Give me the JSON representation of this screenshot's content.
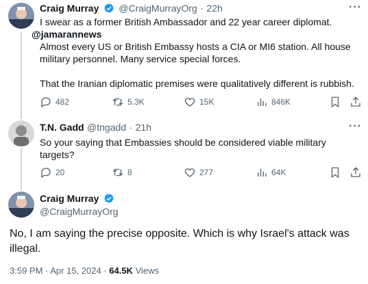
{
  "watermark": "@jamarannews",
  "tweet1": {
    "name": "Craig Murray",
    "handle": "@CraigMurrayOrg",
    "time": "22h",
    "line1": "I swear as a former British Ambassador and 22 year career diplomat.",
    "line2": "Almost every US or British Embassy hosts a CIA or MI6 station. All house",
    "line3": "military personnel.  Many service special forces.",
    "line4": "That the Iranian diplomatic premises were qualitatively different is rubbish.",
    "replies": "482",
    "retweets": "5.3K",
    "likes": "15K",
    "views": "846K"
  },
  "tweet2": {
    "name": "T.N. Gadd",
    "handle": "@tngadd",
    "time": "21h",
    "line1": "So your saying that Embassies should be considered viable military",
    "line2": "targets?",
    "replies": "20",
    "retweets": "8",
    "likes": "277",
    "views": "64K"
  },
  "tweet3": {
    "name": "Craig Murray",
    "handle": "@CraigMurrayOrg",
    "line1": "No, I am saying the precise opposite. Which is why Israel's attack was",
    "line2": "illegal.",
    "timestamp": "3:59 PM · Apr 15, 2024 · ",
    "views_count": "64.5K",
    "views_label": " Views"
  },
  "sep": "·",
  "more_glyph": "···",
  "colors": {
    "verified": "#1d9bf0",
    "muted": "#536471",
    "text": "#0f1419"
  }
}
